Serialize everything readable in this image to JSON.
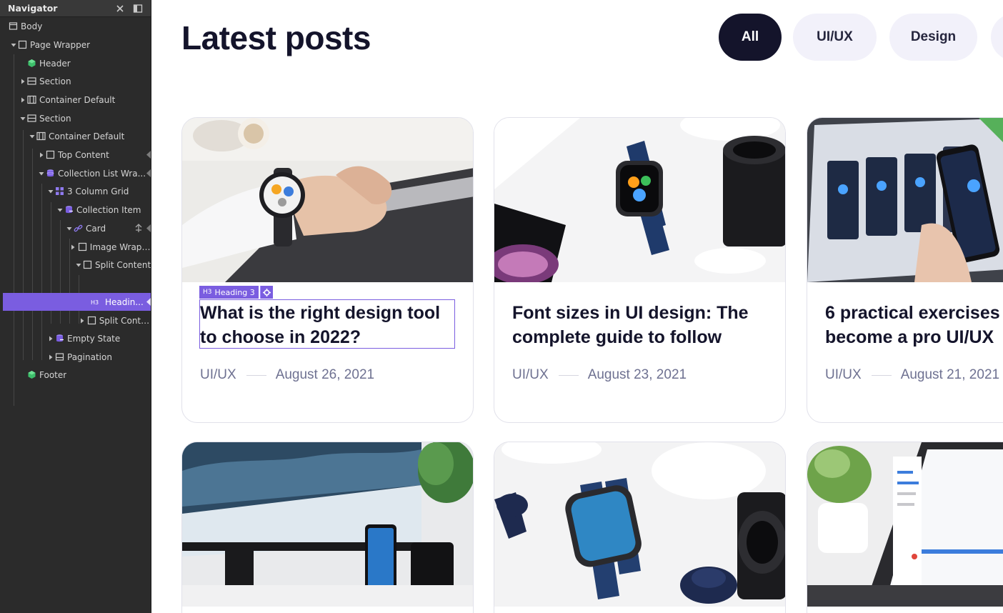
{
  "navigator": {
    "title": "Navigator",
    "items": [
      {
        "label": "Body",
        "icon": "body-box-icon",
        "caret": "none"
      },
      {
        "label": "Page Wrapper",
        "icon": "square-icon",
        "caret": "expanded"
      },
      {
        "label": "Header",
        "icon": "symbol-icon",
        "caret": "none"
      },
      {
        "label": "Section",
        "icon": "section-icon",
        "caret": "collapsed"
      },
      {
        "label": "Container Default",
        "icon": "container-icon",
        "caret": "collapsed"
      },
      {
        "label": "Section",
        "icon": "section-icon",
        "caret": "expanded"
      },
      {
        "label": "Container Default",
        "icon": "container-icon",
        "caret": "expanded"
      },
      {
        "label": "Top Content",
        "icon": "square-icon",
        "caret": "collapsed"
      },
      {
        "label": "Collection List Wra...",
        "icon": "collection-icon",
        "caret": "expanded"
      },
      {
        "label": "3 Column Grid",
        "icon": "grid-icon",
        "caret": "expanded"
      },
      {
        "label": "Collection Item",
        "icon": "collection-item-icon",
        "caret": "expanded"
      },
      {
        "label": "Card",
        "icon": "link-icon",
        "caret": "expanded"
      },
      {
        "label": "Image Wrapper",
        "icon": "square-icon",
        "caret": "collapsed"
      },
      {
        "label": "Split Content",
        "icon": "square-icon",
        "caret": "expanded"
      },
      {
        "label": "Headin...",
        "icon": "h3-icon",
        "caret": "none",
        "selected": true
      },
      {
        "label": "Split Content",
        "icon": "square-icon",
        "caret": "collapsed"
      },
      {
        "label": "Empty State",
        "icon": "collection-icon",
        "caret": "collapsed"
      },
      {
        "label": "Pagination",
        "icon": "pagination-icon",
        "caret": "collapsed"
      },
      {
        "label": "Footer",
        "icon": "symbol-icon",
        "caret": "none"
      }
    ]
  },
  "page": {
    "title": "Latest posts",
    "filters": [
      "All",
      "UI/UX",
      "Design"
    ],
    "active_filter": "All"
  },
  "selection": {
    "tag_prefix": "H3",
    "tag_label": "Heading 3"
  },
  "posts": [
    {
      "title_line1": "What is the right design tool",
      "title_line2": "to choose in 2022?",
      "category": "UI/UX",
      "date": "August 26, 2021",
      "image": "hand-with-smartwatch-on-laptop"
    },
    {
      "title_line1": "Font sizes in UI design: The",
      "title_line2": "complete guide to follow",
      "category": "UI/UX",
      "date": "August 23, 2021",
      "image": "smartwatch-and-camera-lens"
    },
    {
      "title_line1": "6 practical exercises to",
      "title_line2": "become a pro UI/UX",
      "category": "UI/UX",
      "date": "August 21, 2021",
      "image": "phone-and-design-mockups"
    },
    {
      "title_line1": "",
      "title_line2": "",
      "category": "",
      "date": "",
      "image": "monitor-with-snowy-forest"
    },
    {
      "title_line1": "",
      "title_line2": "",
      "category": "",
      "date": "",
      "image": "blue-smartwatch-and-lens"
    },
    {
      "title_line1": "",
      "title_line2": "",
      "category": "",
      "date": "",
      "image": "tablet-with-plant"
    }
  ],
  "colors": {
    "accent": "#7a5de0",
    "dark": "#14142b",
    "pill_bg": "#f2f1fa",
    "meta_text": "#6e7191"
  }
}
